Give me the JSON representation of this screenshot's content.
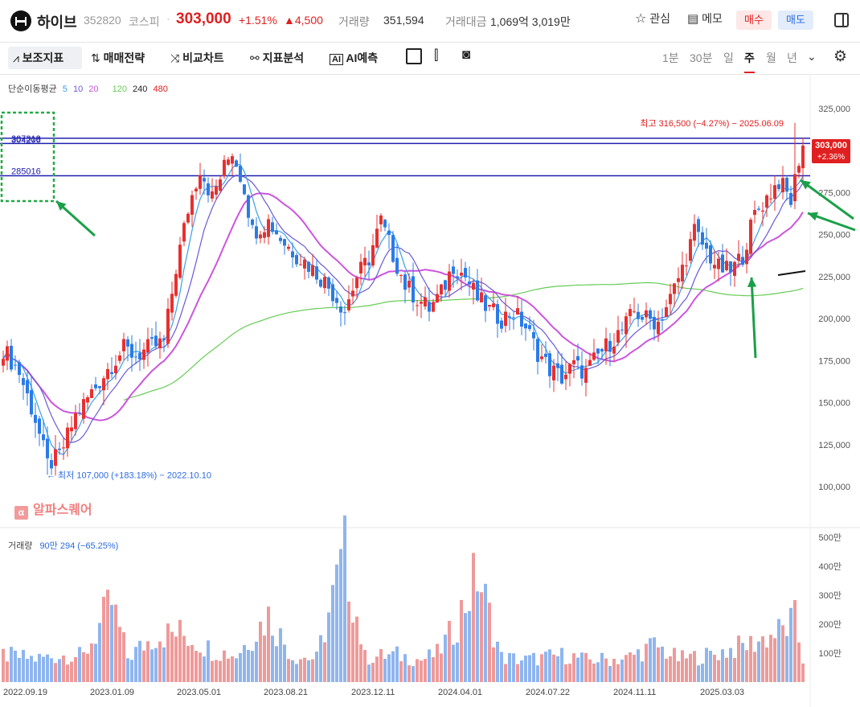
{
  "header": {
    "name": "하이브",
    "code": "352820",
    "market": "코스피",
    "dot": "·",
    "price": "303,000",
    "change_pct": "+1.51%",
    "change_abs": "▲4,500",
    "volume_label": "거래량",
    "volume_value": "351,594",
    "amount_label": "거래대금",
    "amount_value": "1,069억 3,019만",
    "watch_label": "관심",
    "memo_label": "메모",
    "buy_label": "매수",
    "sell_label": "매도"
  },
  "toolbar": {
    "items": [
      "보조지표",
      "매매전략",
      "비교차트",
      "지표분석",
      "AI예측"
    ],
    "timeframes": [
      "1분",
      "30분",
      "일",
      "주",
      "월",
      "년"
    ],
    "active_timeframe": "주"
  },
  "ma_legend": {
    "title": "단순이동평균",
    "periods": [
      {
        "label": "5",
        "color": "#3aa0e8"
      },
      {
        "label": "10",
        "color": "#6a5ad8"
      },
      {
        "label": "20",
        "color": "#cc55dd"
      },
      {
        "label": "120",
        "color": "#66cc55"
      },
      {
        "label": "240",
        "color": "#222222"
      },
      {
        "label": "480",
        "color": "#e02020"
      }
    ]
  },
  "volume_legend": {
    "label": "거래량",
    "value": "90만 294 (−65.25%)"
  },
  "brand": "알파스퀘어",
  "chart_data": {
    "type": "candlestick",
    "price_axis_ticks": [
      "325,000",
      "300,000",
      "275,000",
      "250,000",
      "225,000",
      "200,000",
      "175,000",
      "150,000",
      "125,000",
      "100,000"
    ],
    "price_axis_values": [
      325000,
      300000,
      275000,
      250000,
      225000,
      200000,
      175000,
      150000,
      125000,
      100000
    ],
    "ylim": [
      100000,
      325000
    ],
    "volume_axis_ticks": [
      "500만",
      "400만",
      "300만",
      "200만",
      "100만"
    ],
    "volume_axis_values": [
      500,
      400,
      300,
      200,
      100
    ],
    "x_ticks": [
      "2022.09.19",
      "2023.01.09",
      "2023.05.01",
      "2023.08.21",
      "2023.12.11",
      "2024.04.01",
      "2024.07.22",
      "2024.11.11",
      "2025.03.03"
    ],
    "current_price_label": "303,000",
    "current_change_label": "+2.36%",
    "current_price": 303000,
    "high_annotation": "최고 316,500 (−4.27%) − 2025.06.09",
    "high_value": 316500,
    "low_annotation": "최저 107,000 (+183.18%) − 2022.10.10",
    "low_value": 107000,
    "horizontal_lines": [
      {
        "label": "307318",
        "value": 307318
      },
      {
        "label": "304206",
        "value": 304206
      },
      {
        "label": "285016",
        "value": 285016
      }
    ],
    "close_anchors": [
      [
        0,
        182000
      ],
      [
        4,
        168000
      ],
      [
        8,
        140000
      ],
      [
        11,
        113000
      ],
      [
        14,
        118000
      ],
      [
        18,
        142000
      ],
      [
        22,
        156000
      ],
      [
        26,
        170000
      ],
      [
        30,
        182000
      ],
      [
        33,
        178000
      ],
      [
        36,
        182000
      ],
      [
        40,
        186000
      ],
      [
        43,
        230000
      ],
      [
        46,
        265000
      ],
      [
        49,
        290000
      ],
      [
        52,
        272000
      ],
      [
        55,
        290000
      ],
      [
        57,
        300000
      ],
      [
        60,
        278000
      ],
      [
        62,
        252000
      ],
      [
        66,
        258000
      ],
      [
        70,
        245000
      ],
      [
        73,
        238000
      ],
      [
        76,
        232000
      ],
      [
        80,
        222000
      ],
      [
        83,
        212000
      ],
      [
        85,
        205000
      ],
      [
        88,
        225000
      ],
      [
        91,
        236000
      ],
      [
        94,
        258000
      ],
      [
        97,
        238000
      ],
      [
        100,
        220000
      ],
      [
        103,
        212000
      ],
      [
        106,
        206000
      ],
      [
        109,
        215000
      ],
      [
        112,
        232000
      ],
      [
        115,
        225000
      ],
      [
        118,
        212000
      ],
      [
        121,
        205000
      ],
      [
        124,
        200000
      ],
      [
        127,
        204000
      ],
      [
        130,
        195000
      ],
      [
        133,
        180000
      ],
      [
        136,
        170000
      ],
      [
        139,
        165000
      ],
      [
        142,
        172000
      ],
      [
        145,
        168000
      ],
      [
        148,
        178000
      ],
      [
        151,
        186000
      ],
      [
        154,
        193000
      ],
      [
        157,
        204000
      ],
      [
        160,
        200000
      ],
      [
        163,
        198000
      ],
      [
        166,
        212000
      ],
      [
        169,
        230000
      ],
      [
        172,
        252000
      ],
      [
        175,
        240000
      ],
      [
        178,
        230000
      ],
      [
        181,
        228000
      ],
      [
        184,
        238000
      ],
      [
        187,
        262000
      ],
      [
        190,
        272000
      ],
      [
        193,
        282000
      ],
      [
        196,
        270000
      ],
      [
        198,
        295000
      ],
      [
        199,
        303000
      ]
    ],
    "volume_anchors": [
      [
        0,
        110
      ],
      [
        8,
        95
      ],
      [
        16,
        110
      ],
      [
        20,
        105
      ],
      [
        27,
        320
      ],
      [
        31,
        100
      ],
      [
        38,
        190
      ],
      [
        44,
        200
      ],
      [
        52,
        130
      ],
      [
        58,
        110
      ],
      [
        66,
        270
      ],
      [
        72,
        105
      ],
      [
        78,
        95
      ],
      [
        85,
        520
      ],
      [
        90,
        100
      ],
      [
        98,
        110
      ],
      [
        104,
        90
      ],
      [
        108,
        115
      ],
      [
        112,
        210
      ],
      [
        118,
        440
      ],
      [
        124,
        100
      ],
      [
        130,
        90
      ],
      [
        140,
        110
      ],
      [
        145,
        90
      ],
      [
        155,
        95
      ],
      [
        162,
        150
      ],
      [
        168,
        95
      ],
      [
        176,
        110
      ],
      [
        186,
        155
      ],
      [
        194,
        210
      ],
      [
        197,
        250
      ],
      [
        199,
        90
      ]
    ],
    "ma_colors": {
      "ma5": "#3aa0e8",
      "ma10": "#6a5ad8",
      "ma20": "#cc55dd",
      "ma120": "#66cc55"
    }
  }
}
